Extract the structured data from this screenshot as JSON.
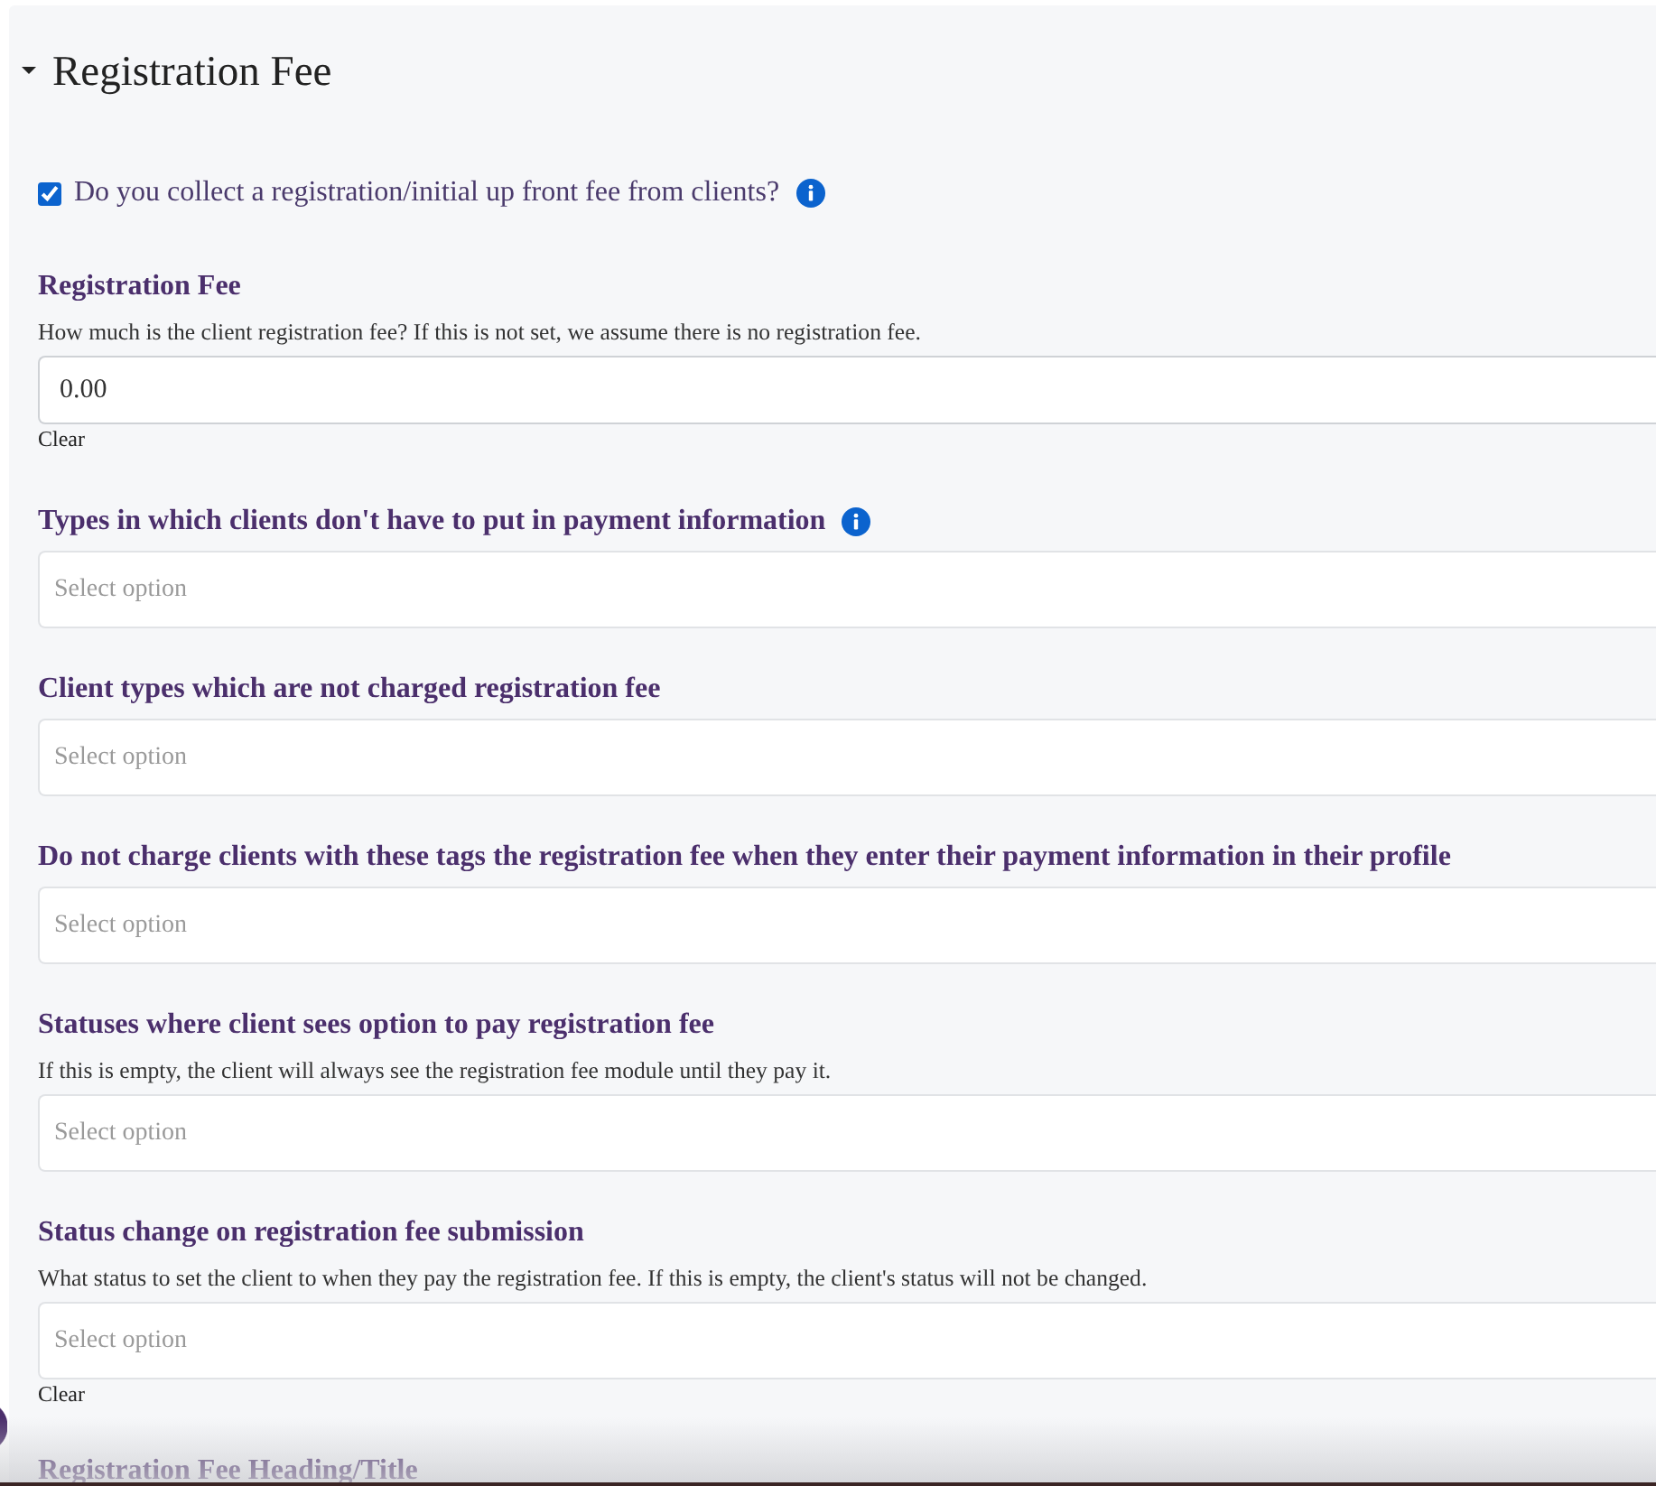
{
  "section": {
    "title": "Registration Fee",
    "expanded": true
  },
  "collect_fee": {
    "label": "Do you collect a registration/initial up front fee from clients?",
    "checked": true,
    "info": true
  },
  "fields": [
    {
      "kind": "text",
      "label": "Registration Fee",
      "info": false,
      "help": "How much is the client registration fee? If this is not set, we assume there is no registration fee.",
      "value": "0.00",
      "clear": "Clear"
    },
    {
      "kind": "select",
      "label": "Types in which clients don't have to put in payment information",
      "info": true,
      "placeholder": "Select option"
    },
    {
      "kind": "select",
      "label": "Client types which are not charged registration fee",
      "info": false,
      "placeholder": "Select option"
    },
    {
      "kind": "select",
      "label": "Do not charge clients with these tags the registration fee when they enter their payment information in their profile",
      "info": false,
      "placeholder": "Select option"
    },
    {
      "kind": "select",
      "label": "Statuses where client sees option to pay registration fee",
      "info": false,
      "help": "If this is empty, the client will always see the registration fee module until they pay it.",
      "placeholder": "Select option"
    },
    {
      "kind": "select",
      "label": "Status change on registration fee submission",
      "info": false,
      "help": "What status to set the client to when they pay the registration fee. If this is empty, the client's status will not be changed.",
      "placeholder": "Select option",
      "clear": "Clear"
    },
    {
      "kind": "label",
      "label": "Registration Fee Heading/Title",
      "info": false
    }
  ]
}
